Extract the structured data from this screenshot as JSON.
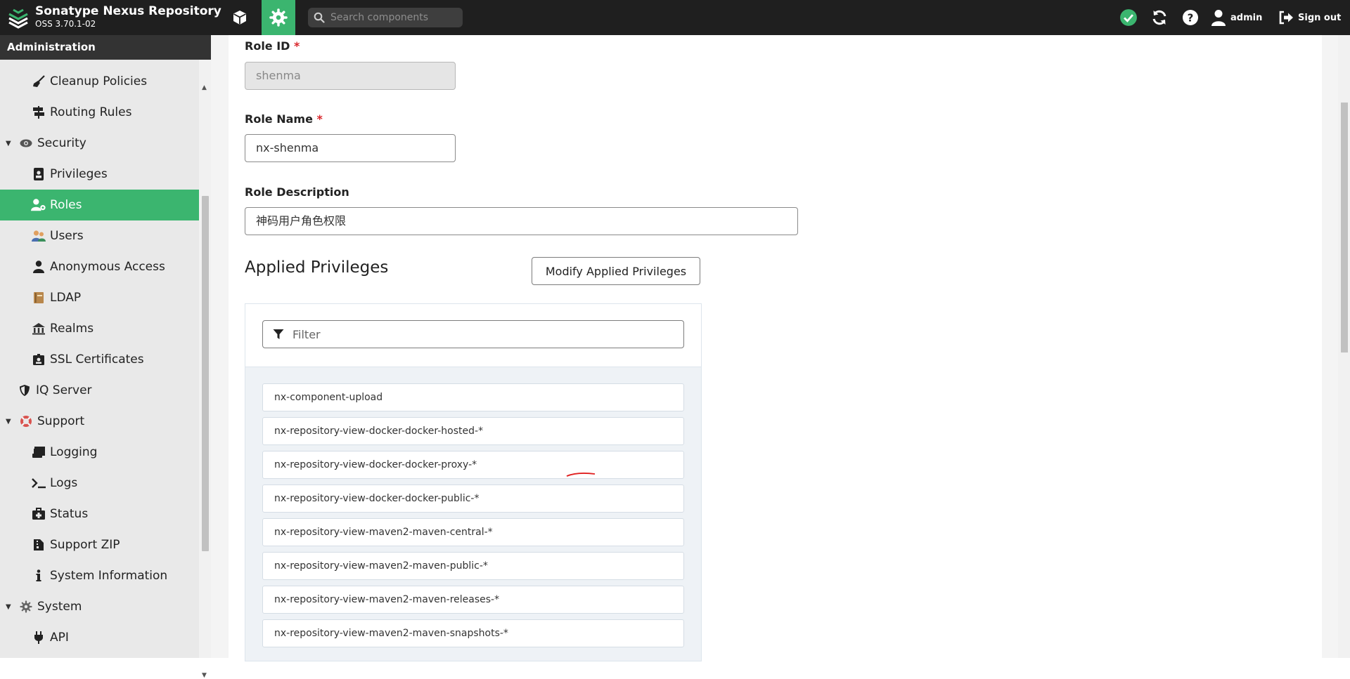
{
  "header": {
    "app_name": "Sonatype Nexus Repository",
    "app_version": "OSS 3.70.1-02",
    "search_placeholder": "Search components",
    "user_name": "admin",
    "signout_label": "Sign out",
    "accent_color": "#3bb56f",
    "icons": [
      "nexus-logo-icon",
      "cube-icon",
      "gear-icon",
      "search-icon",
      "check-circle-icon",
      "refresh-icon",
      "question-icon",
      "user-icon",
      "sign-out-icon"
    ]
  },
  "sidebar": {
    "title": "Administration",
    "items": [
      {
        "label": "Cleanup Policies",
        "icon": "broom-icon"
      },
      {
        "label": "Routing Rules",
        "icon": "signpost-icon"
      },
      {
        "label": "Security",
        "icon": "eye-icon",
        "expanded": true
      },
      {
        "label": "Privileges",
        "icon": "id-badge-icon"
      },
      {
        "label": "Roles",
        "icon": "user-gear-icon",
        "selected": true
      },
      {
        "label": "Users",
        "icon": "users-icon"
      },
      {
        "label": "Anonymous Access",
        "icon": "user-icon"
      },
      {
        "label": "LDAP",
        "icon": "book-icon"
      },
      {
        "label": "Realms",
        "icon": "realms-icon"
      },
      {
        "label": "SSL Certificates",
        "icon": "id-card-icon"
      },
      {
        "label": "IQ Server",
        "icon": "shield-icon"
      },
      {
        "label": "Support",
        "icon": "lifebuoy-icon",
        "expanded": true
      },
      {
        "label": "Logging",
        "icon": "scroll-icon"
      },
      {
        "label": "Logs",
        "icon": "terminal-icon"
      },
      {
        "label": "Status",
        "icon": "medkit-icon"
      },
      {
        "label": "Support ZIP",
        "icon": "file-zip-icon"
      },
      {
        "label": "System Information",
        "icon": "info-icon"
      },
      {
        "label": "System",
        "icon": "gear-icon",
        "expanded": true
      },
      {
        "label": "API",
        "icon": "plug-icon"
      }
    ]
  },
  "form": {
    "role_id_label": "Role ID",
    "role_id_value": "shenma",
    "role_name_label": "Role Name",
    "role_name_value": "nx-shenma",
    "role_desc_label": "Role Description",
    "role_desc_value": "神码用户角色权限",
    "required_marker": "*",
    "applied_title": "Applied Privileges",
    "modify_button": "Modify Applied Privileges",
    "filter_placeholder": "Filter"
  },
  "privileges": [
    "nx-component-upload",
    "nx-repository-view-docker-docker-hosted-*",
    "nx-repository-view-docker-docker-proxy-*",
    "nx-repository-view-docker-docker-public-*",
    "nx-repository-view-maven2-maven-central-*",
    "nx-repository-view-maven2-maven-public-*",
    "nx-repository-view-maven2-maven-releases-*",
    "nx-repository-view-maven2-maven-snapshots-*"
  ]
}
